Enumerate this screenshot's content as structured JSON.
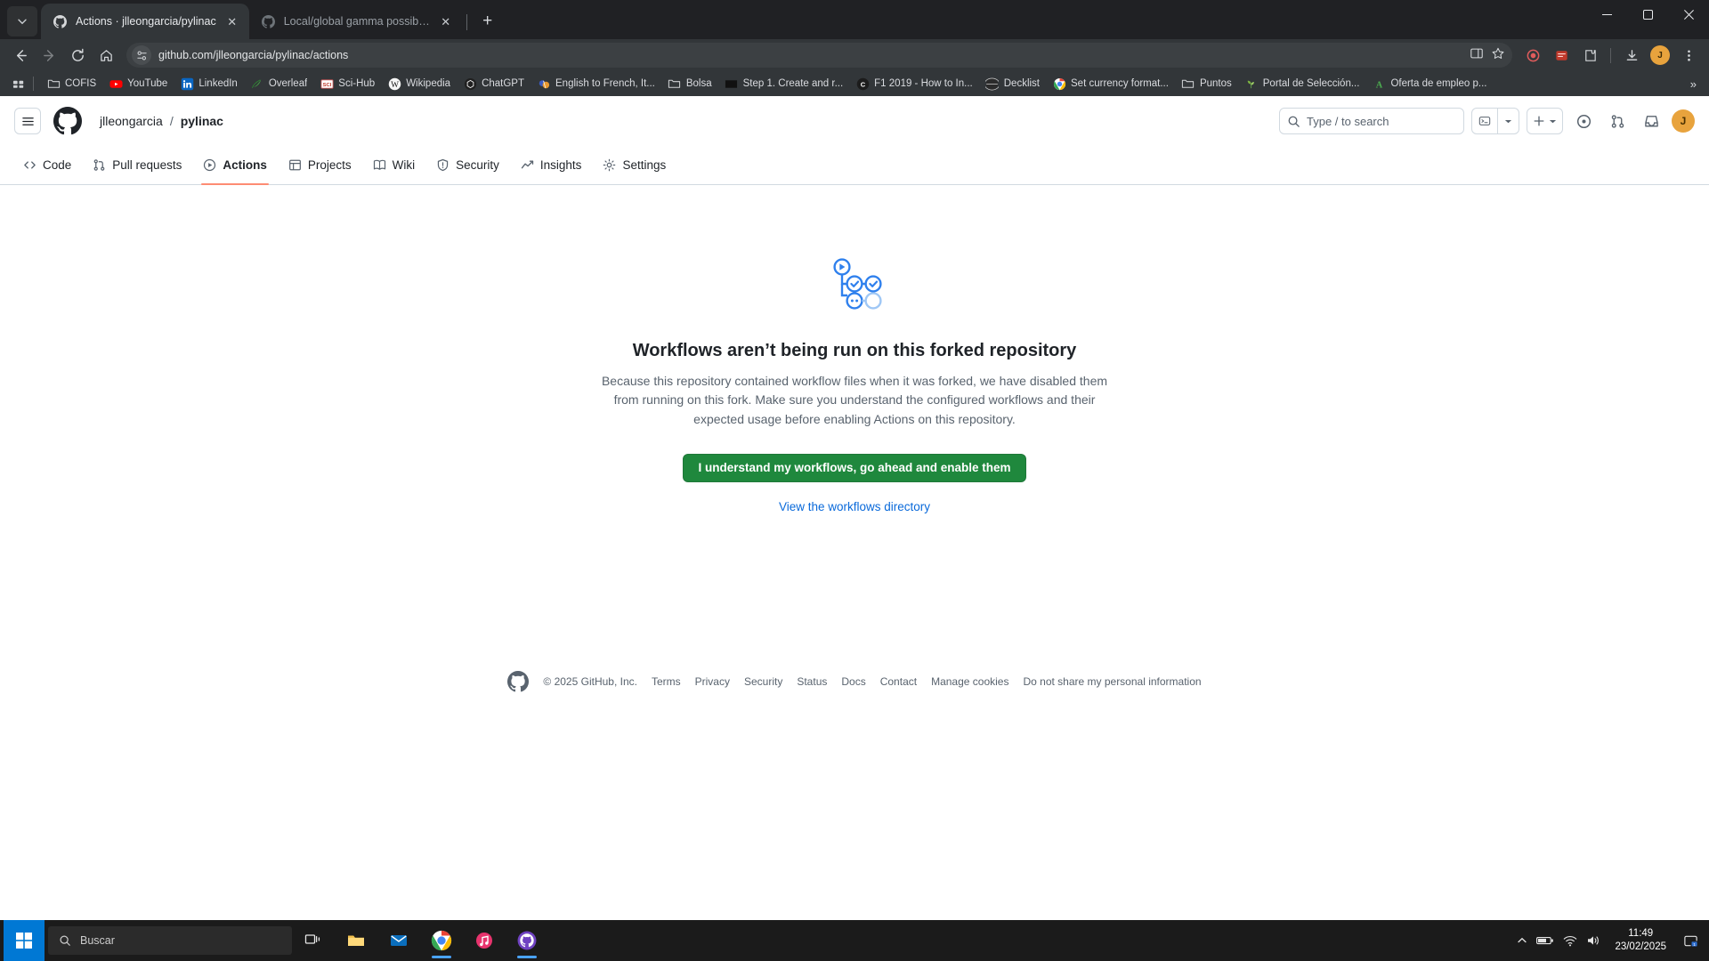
{
  "browser": {
    "tabs": [
      {
        "title": "Actions · jlleongarcia/pylinac",
        "icon": "github-icon",
        "active": true
      },
      {
        "title": "Local/global gamma possibility",
        "icon": "github-icon",
        "active": false
      }
    ],
    "tab_search_icon": "chevron-down-icon",
    "new_tab_icon": "plus-icon",
    "window_controls": {
      "minimize": "minimize-icon",
      "maximize": "maximize-icon",
      "close": "close-icon"
    },
    "toolbar": {
      "back_icon": "arrow-left-icon",
      "forward_icon": "arrow-right-icon",
      "reload_icon": "reload-icon",
      "home_icon": "home-icon",
      "site_info_icon": "page-settings-icon",
      "url": "github.com/jlleongarcia/pylinac/actions",
      "url_prefix": "github.com",
      "url_path": "/jlleongarcia/pylinac/actions",
      "split_screen_icon": "split-screen-icon",
      "bookmark_icon": "star-icon",
      "extensions": [
        "record-icon",
        "extension-red-icon",
        "puzzle-icon"
      ],
      "downloads_icon": "download-icon",
      "profile_icon": "profile-icon",
      "menu_icon": "kebab-menu-icon",
      "avatar_letter": "J"
    },
    "bookmarks": {
      "apps_icon": "apps-grid-icon",
      "overflow_icon": "chevrons-right-icon",
      "items": [
        {
          "label": "COFIS",
          "icon": "folder-icon"
        },
        {
          "label": "YouTube",
          "icon": "youtube-icon"
        },
        {
          "label": "LinkedIn",
          "icon": "linkedin-icon"
        },
        {
          "label": "Overleaf",
          "icon": "overleaf-icon"
        },
        {
          "label": "Sci-Hub",
          "icon": "scihub-icon"
        },
        {
          "label": "Wikipedia",
          "icon": "wikipedia-icon"
        },
        {
          "label": "ChatGPT",
          "icon": "chatgpt-icon"
        },
        {
          "label": "English to French, It...",
          "icon": "translate-icon"
        },
        {
          "label": "Bolsa",
          "icon": "folder-icon"
        },
        {
          "label": "Step 1. Create and r...",
          "icon": "dark-square-icon"
        },
        {
          "label": "F1 2019 - How to In...",
          "icon": "f1-icon"
        },
        {
          "label": "Decklist",
          "icon": "globe-dark-icon"
        },
        {
          "label": "Set currency format...",
          "icon": "chrome-icon"
        },
        {
          "label": "Puntos",
          "icon": "folder-icon"
        },
        {
          "label": "Portal de Selección...",
          "icon": "plant-icon"
        },
        {
          "label": "Oferta de empleo p...",
          "icon": "acrobat-icon"
        }
      ]
    }
  },
  "github": {
    "header": {
      "menu_icon": "hamburger-icon",
      "logo_icon": "github-mark-icon",
      "owner": "jlleongarcia",
      "separator": "/",
      "repo": "pylinac",
      "search_placeholder": "Type / to search",
      "search_icon": "search-icon",
      "command_palette_icon": "command-palette-icon",
      "command_palette_caret_icon": "triangle-down-icon",
      "create_new_icon": "plus-icon",
      "create_new_caret_icon": "triangle-down-icon",
      "issues_icon": "issue-opened-icon",
      "pull_requests_icon": "git-pull-request-icon",
      "inbox_icon": "inbox-icon",
      "avatar_letter": "J"
    },
    "nav": [
      {
        "label": "Code",
        "icon": "code-icon",
        "selected": false
      },
      {
        "label": "Pull requests",
        "icon": "git-pull-request-icon",
        "selected": false
      },
      {
        "label": "Actions",
        "icon": "play-circle-icon",
        "selected": true
      },
      {
        "label": "Projects",
        "icon": "table-icon",
        "selected": false
      },
      {
        "label": "Wiki",
        "icon": "book-icon",
        "selected": false
      },
      {
        "label": "Security",
        "icon": "shield-icon",
        "selected": false
      },
      {
        "label": "Insights",
        "icon": "graph-icon",
        "selected": false
      },
      {
        "label": "Settings",
        "icon": "gear-icon",
        "selected": false
      }
    ],
    "blankslate": {
      "icon": "workflow-graph-icon",
      "title": "Workflows aren’t being run on this forked repository",
      "description": "Because this repository contained workflow files when it was forked, we have disabled them from running on this fork. Make sure you understand the configured workflows and their expected usage before enabling Actions on this repository.",
      "primary_button": "I understand my workflows, go ahead and enable them",
      "secondary_link": "View the workflows directory"
    },
    "footer": {
      "logo_icon": "github-mark-icon",
      "copyright": "© 2025 GitHub, Inc.",
      "links": [
        "Terms",
        "Privacy",
        "Security",
        "Status",
        "Docs",
        "Contact",
        "Manage cookies",
        "Do not share my personal information"
      ]
    },
    "colors": {
      "accent_green": "#1f883d",
      "link_blue": "#0969da",
      "selected_underline": "#fd8c73",
      "border": "#d1d9e0",
      "muted_text": "#59636e"
    }
  },
  "taskbar": {
    "start_icon": "windows-icon",
    "search_placeholder": "Buscar",
    "search_icon": "search-icon",
    "items": [
      {
        "name": "task-view",
        "icon": "task-view-icon",
        "running": false
      },
      {
        "name": "file-explorer",
        "icon": "folder-icon",
        "running": false
      },
      {
        "name": "mail",
        "icon": "mail-icon",
        "running": false
      },
      {
        "name": "chrome",
        "icon": "chrome-icon",
        "running": true
      },
      {
        "name": "music",
        "icon": "music-icon",
        "running": false
      },
      {
        "name": "github-desktop",
        "icon": "github-icon",
        "running": true
      }
    ],
    "tray": {
      "expand_icon": "chevron-up-icon",
      "battery_icon": "battery-icon",
      "network_icon": "wifi-icon",
      "volume_icon": "volume-icon",
      "notifications_icon": "notification-icon"
    },
    "clock": {
      "time": "11:49",
      "date": "23/02/2025"
    }
  }
}
